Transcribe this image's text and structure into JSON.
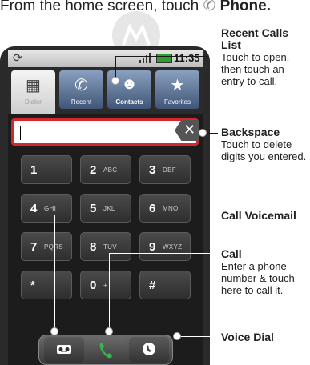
{
  "intro": {
    "text": "From the home screen, touch",
    "emphasis": "Phone."
  },
  "status": {
    "time": "11:35",
    "sync_icon": "sync-icon",
    "signal_icon": "signal-icon",
    "battery_icon": "battery-icon"
  },
  "tabs": [
    {
      "label": "Dialer",
      "icon": "dialpad-icon",
      "active": true
    },
    {
      "label": "Recent",
      "icon": "recent-calls-icon",
      "active": false
    },
    {
      "label": "Contacts",
      "icon": "contacts-icon",
      "active": false
    },
    {
      "label": "Favorites",
      "icon": "star-icon",
      "active": false
    }
  ],
  "entry": {
    "value": ""
  },
  "keys": [
    {
      "digit": "1",
      "letters": ""
    },
    {
      "digit": "2",
      "letters": "ABC"
    },
    {
      "digit": "3",
      "letters": "DEF"
    },
    {
      "digit": "4",
      "letters": "GHI"
    },
    {
      "digit": "5",
      "letters": "JKL"
    },
    {
      "digit": "6",
      "letters": "MNO"
    },
    {
      "digit": "7",
      "letters": "PQRS"
    },
    {
      "digit": "8",
      "letters": "TUV"
    },
    {
      "digit": "9",
      "letters": "WXYZ"
    },
    {
      "digit": "*",
      "letters": ""
    },
    {
      "digit": "0",
      "letters": "+"
    },
    {
      "digit": "#",
      "letters": ""
    }
  ],
  "callouts": {
    "recent": {
      "title": "Recent Calls List",
      "text": "Touch to open, then touch an entry to call."
    },
    "backspace": {
      "title": "Backspace",
      "text": "Touch to delete digits you entered."
    },
    "voicemail": {
      "title": "Call Voicemail"
    },
    "call": {
      "title": "Call",
      "text": "Enter a phone number & touch here to call it."
    },
    "voicedial": {
      "title": "Voice Dial"
    }
  },
  "colors": {
    "accent_red": "#d5282b",
    "call_green": "#3bb54a",
    "tab_blue": "#5a7396"
  }
}
